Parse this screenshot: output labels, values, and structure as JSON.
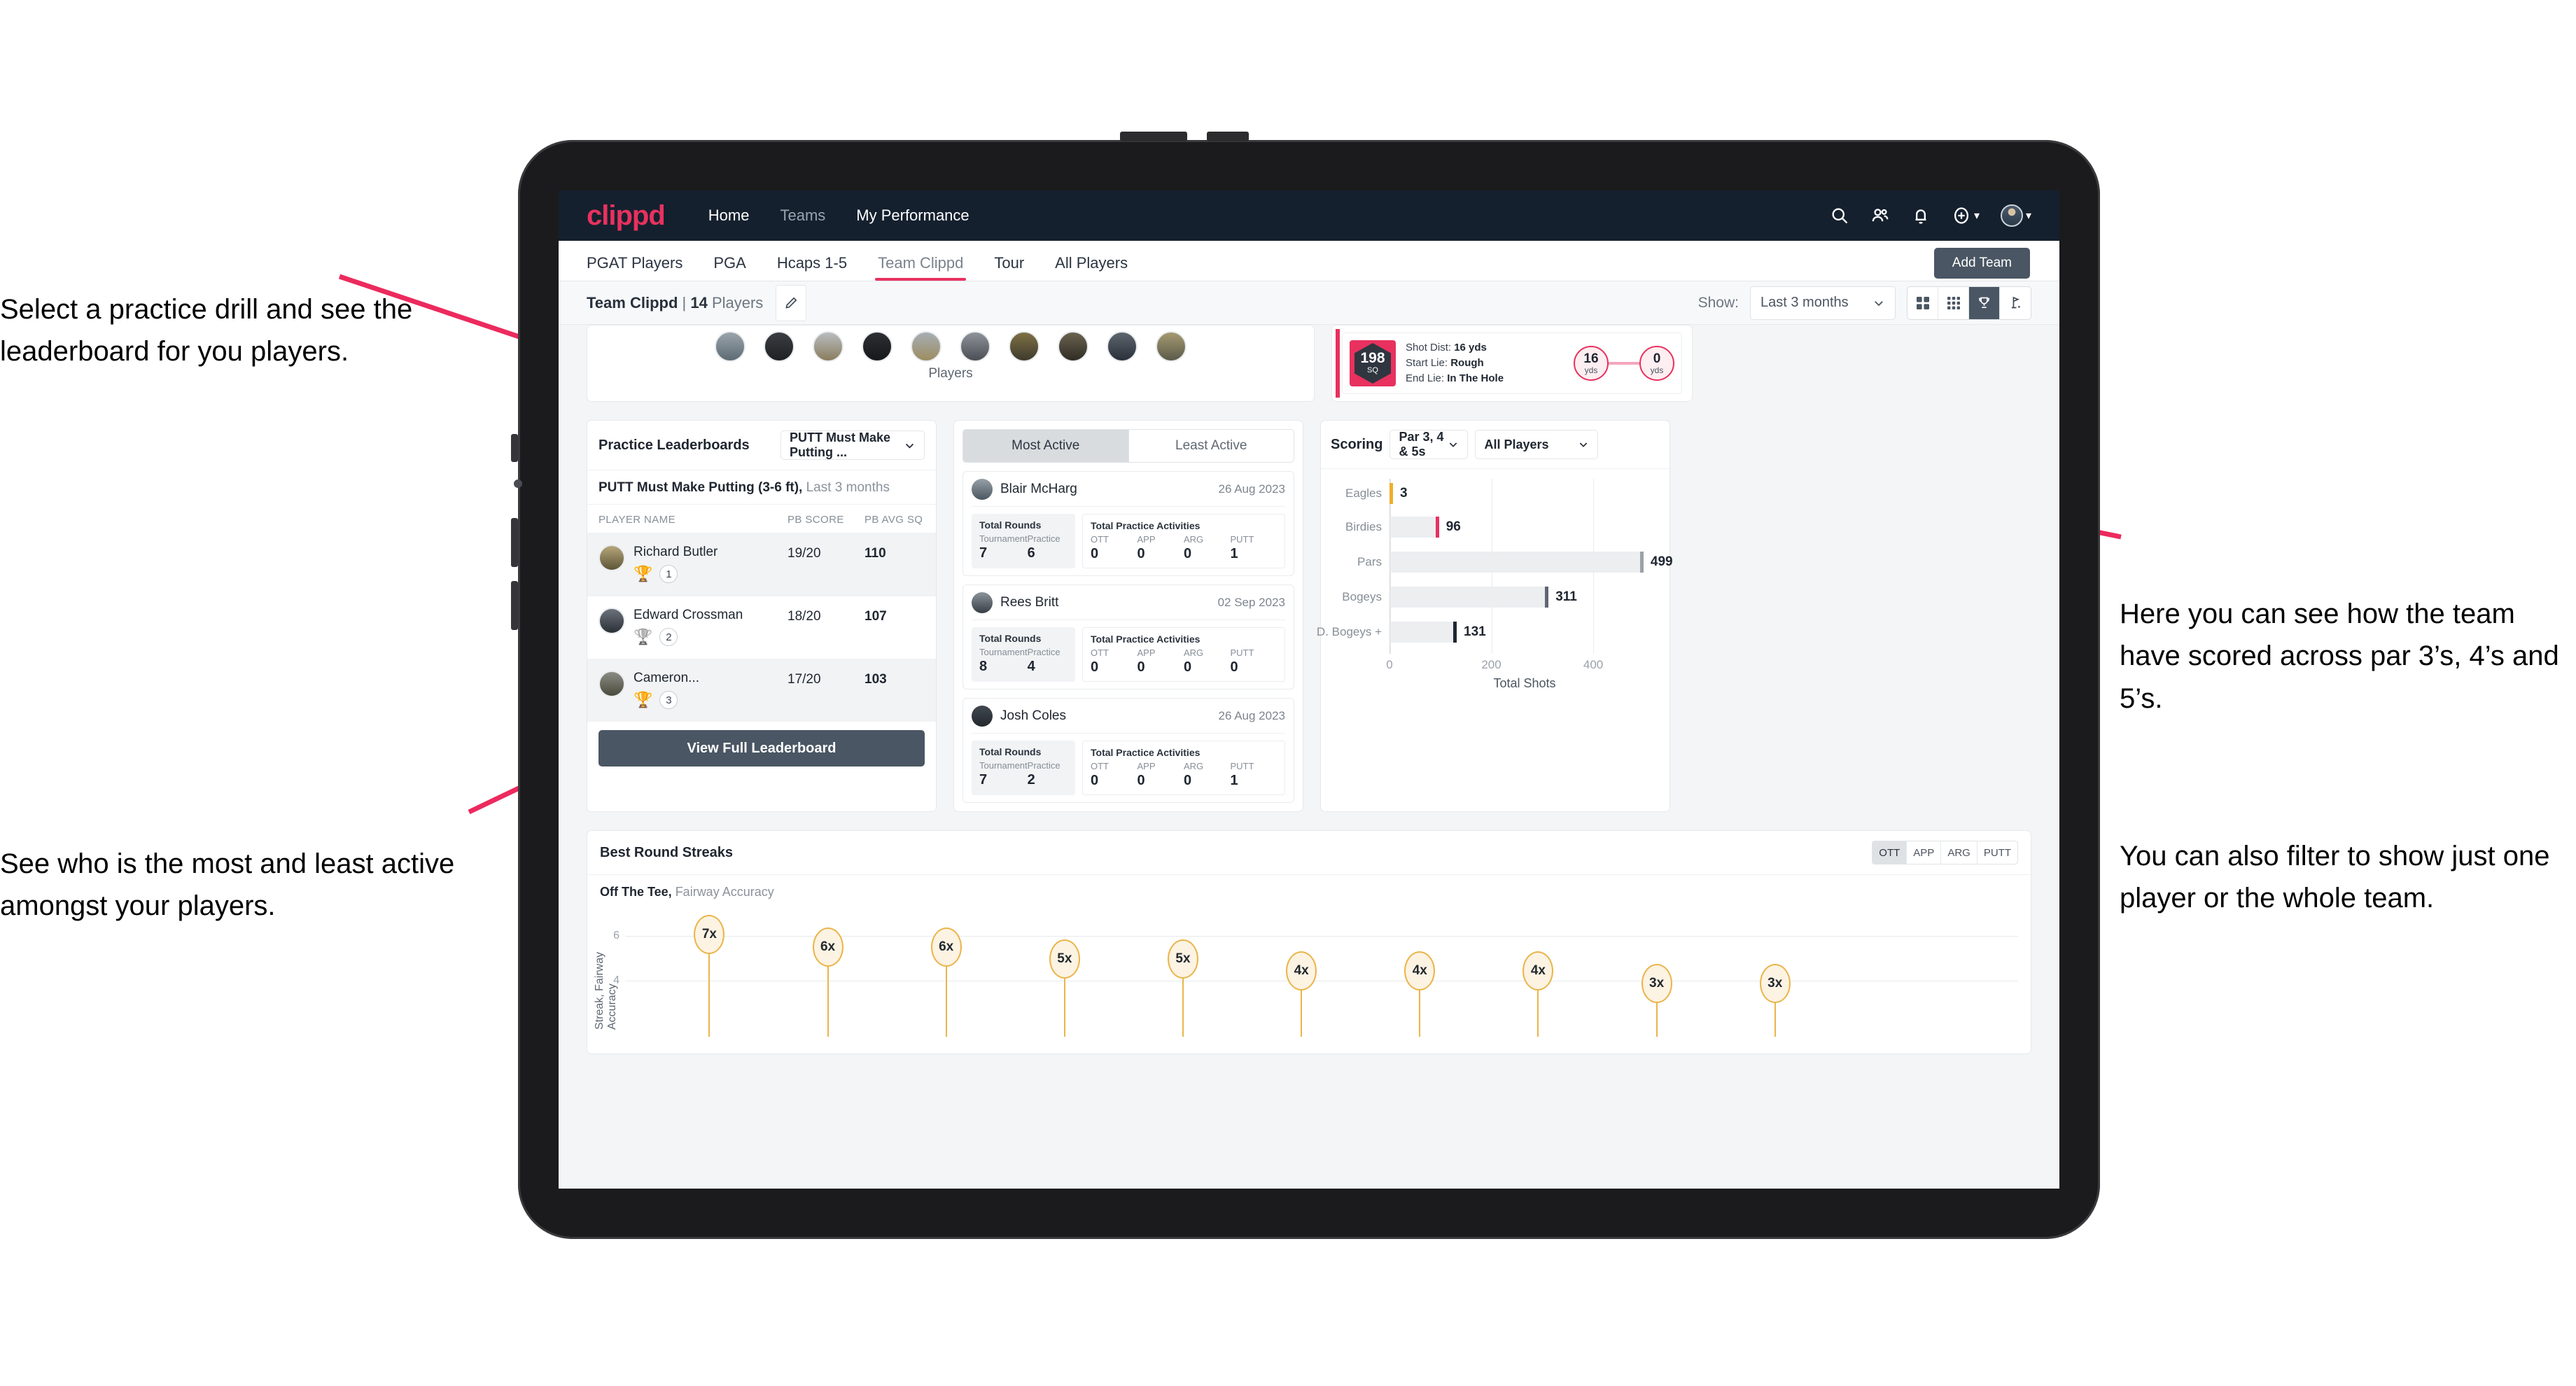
{
  "annotations": {
    "top_left": "Select a practice drill and see the leaderboard for you players.",
    "bottom_left": "See who is the most and least active amongst your players.",
    "right_p1": "Here you can see how the team have scored across par 3’s, 4’s and 5’s.",
    "right_p2": "You can also filter to show just one player or the whole team.",
    "arrow_color": "#ef २"
  },
  "colors": {
    "brand": "#e8315f",
    "navbar_bg": "#15202e",
    "accent_dark": "#4a5663",
    "gold": "#eab54a",
    "content_bg": "#f3f5f6"
  },
  "navbar": {
    "brand": "clippd",
    "links": [
      {
        "label": "Home",
        "state": "active"
      },
      {
        "label": "Teams",
        "state": "dim"
      },
      {
        "label": "My Performance",
        "state": "active"
      }
    ],
    "icons": [
      "search-icon",
      "people-icon",
      "bell-icon",
      "plus-circle-icon",
      "avatar"
    ]
  },
  "tabs": {
    "items": [
      {
        "label": "PGAT Players",
        "active": false
      },
      {
        "label": "PGA",
        "active": false
      },
      {
        "label": "Hcaps 1-5",
        "active": false
      },
      {
        "label": "Team Clippd",
        "active": true
      },
      {
        "label": "Tour",
        "active": false
      },
      {
        "label": "All Players",
        "active": false
      }
    ],
    "add_team_label": "Add Team"
  },
  "toolbar": {
    "team_name": "Team Clippd",
    "separator": " | ",
    "player_count": "14",
    "players_word": "Players",
    "edit_icon": "pencil-icon",
    "show_label": "Show:",
    "range_value": "Last 3 months",
    "views": [
      {
        "icon": "grid-large-icon",
        "active": false
      },
      {
        "icon": "grid-small-icon",
        "active": false
      },
      {
        "icon": "trophy-icon",
        "active": true
      },
      {
        "icon": "golf-flag-icon",
        "active": false
      }
    ]
  },
  "players_card": {
    "caption": "Players",
    "avatar_count": 10
  },
  "shot_card": {
    "badge_number": "198",
    "badge_unit": "SQ",
    "lines": [
      {
        "label": "Shot Dist:",
        "value": "16 yds"
      },
      {
        "label": "Start Lie:",
        "value": "Rough"
      },
      {
        "label": "End Lie:",
        "value": "In The Hole"
      }
    ],
    "start_dot": {
      "value": "16",
      "unit": "yds"
    },
    "end_dot": {
      "value": "0",
      "unit": "yds"
    }
  },
  "leaderboard": {
    "title": "Practice Leaderboards",
    "drill_select": "PUTT Must Make Putting ...",
    "subtitle_bold": "PUTT Must Make Putting (3-6 ft),",
    "subtitle_light": " Last 3 months",
    "columns": [
      "PLAYER NAME",
      "PB SCORE",
      "PB AVG SQ"
    ],
    "rows": [
      {
        "name": "Richard Butler",
        "rank": "1",
        "trophy": "gold",
        "pb_score": "19/20",
        "pb_avg_sq": "110"
      },
      {
        "name": "Edward Crossman",
        "rank": "2",
        "trophy": "silver",
        "pb_score": "18/20",
        "pb_avg_sq": "107"
      },
      {
        "name": "Cameron...",
        "rank": "3",
        "trophy": "bronze",
        "pb_score": "17/20",
        "pb_avg_sq": "103"
      }
    ],
    "button_label": "View Full Leaderboard"
  },
  "activity": {
    "tabs": [
      {
        "label": "Most Active",
        "active": true
      },
      {
        "label": "Least Active",
        "active": false
      }
    ],
    "stat_titles": {
      "rounds": "Total Rounds",
      "practice": "Total Practice Activities"
    },
    "rounds_cols": [
      "Tournament",
      "Practice"
    ],
    "practice_cols": [
      "OTT",
      "APP",
      "ARG",
      "PUTT"
    ],
    "players": [
      {
        "name": "Blair McHarg",
        "date": "26 Aug 2023",
        "rounds": [
          "7",
          "6"
        ],
        "practice": [
          "0",
          "0",
          "0",
          "1"
        ]
      },
      {
        "name": "Rees Britt",
        "date": "02 Sep 2023",
        "rounds": [
          "8",
          "4"
        ],
        "practice": [
          "0",
          "0",
          "0",
          "0"
        ]
      },
      {
        "name": "Josh Coles",
        "date": "26 Aug 2023",
        "rounds": [
          "7",
          "2"
        ],
        "practice": [
          "0",
          "0",
          "0",
          "1"
        ]
      }
    ]
  },
  "scoring": {
    "title": "Scoring",
    "par_filter": "Par 3, 4 & 5s",
    "player_filter": "All Players"
  },
  "streaks": {
    "title": "Best Round Streaks",
    "toggle": [
      {
        "label": "OTT",
        "active": true
      },
      {
        "label": "APP",
        "active": false
      },
      {
        "label": "ARG",
        "active": false
      },
      {
        "label": "PUTT",
        "active": false
      }
    ],
    "subtitle_bold": "Off The Tee,",
    "subtitle_light": " Fairway Accuracy"
  },
  "chart_data": [
    {
      "type": "bar",
      "orientation": "horizontal",
      "title": "Scoring",
      "categories": [
        "Eagles",
        "Birdies",
        "Pars",
        "Bogeys",
        "D. Bogeys +"
      ],
      "values": [
        3,
        96,
        499,
        311,
        131
      ],
      "bar_cap_colors": [
        "#f0ad2a",
        "#e8315f",
        "#9aa1a9",
        "#5e6772",
        "#1f2630"
      ],
      "xlabel": "Total Shots",
      "ylabel": "",
      "xlim": [
        0,
        520
      ],
      "xticks": [
        0,
        200,
        400
      ],
      "grid": true,
      "data_labels": [
        "3",
        "96",
        "499",
        "311",
        "131"
      ]
    },
    {
      "type": "bar",
      "variant": "lollipop",
      "title": "Best Round Streaks",
      "ylabel": "Streak, Fairway Accuracy",
      "xlabel": "",
      "ylim": [
        0,
        8
      ],
      "yticks": [
        4,
        6
      ],
      "grid": true,
      "categories": [
        "",
        "",
        "",
        "",
        "",
        "",
        "",
        "",
        "",
        "",
        ""
      ],
      "values": [
        7,
        6,
        6,
        5,
        5,
        4,
        4,
        4,
        3,
        3
      ],
      "data_labels": [
        "7x",
        "6x",
        "6x",
        "5x",
        "5x",
        "4x",
        "4x",
        "4x",
        "3x",
        "3x"
      ]
    }
  ]
}
